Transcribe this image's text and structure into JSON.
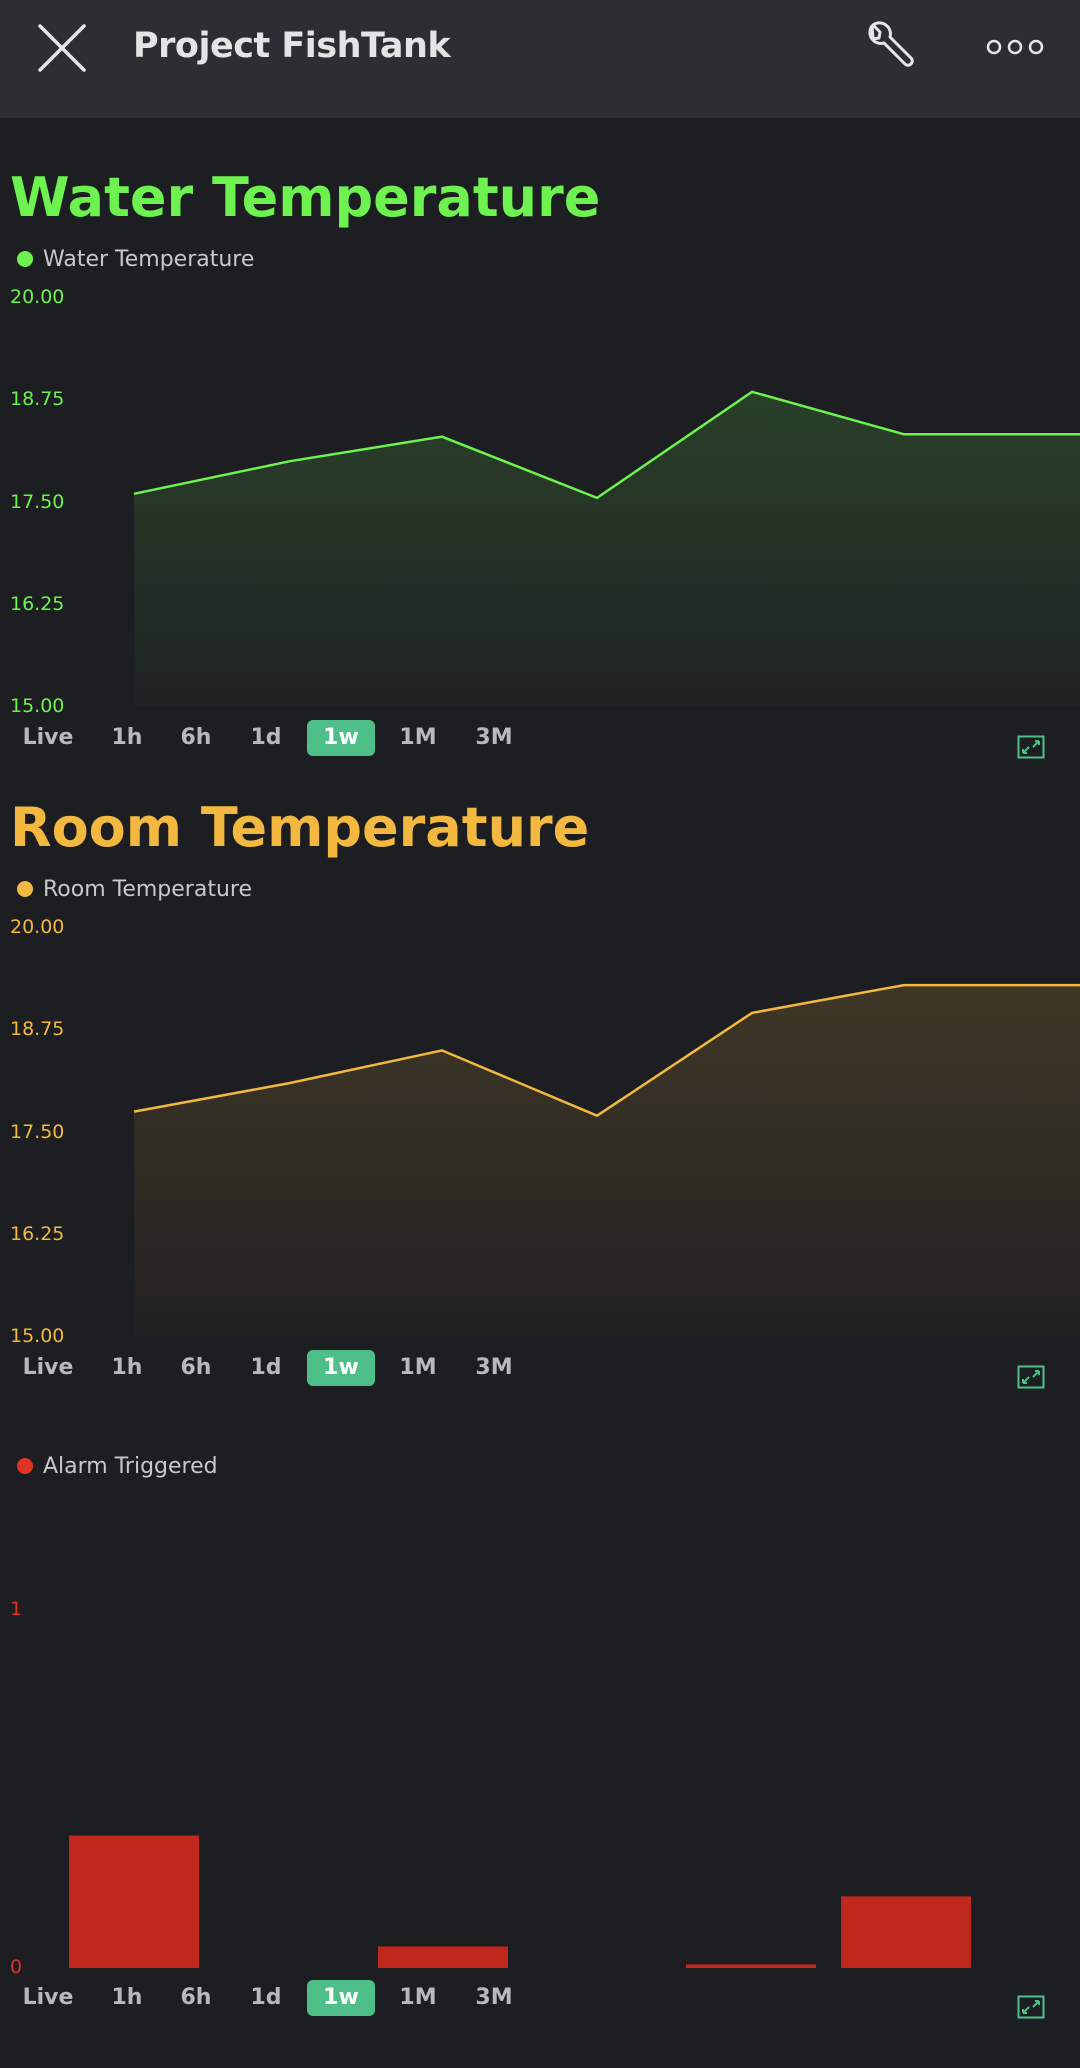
{
  "header": {
    "title": "Project FishTank",
    "icons": {
      "close": "close-icon",
      "settings": "wrench-icon",
      "more": "more-icon"
    }
  },
  "time_ranges": [
    "Live",
    "1h",
    "6h",
    "1d",
    "1w",
    "1M",
    "3M"
  ],
  "active_range": "1w",
  "widgets": {
    "water": {
      "title": "Water Temperature",
      "legend": "Water Temperature",
      "color": "#6ef250",
      "y_ticks": [
        "20.00",
        "18.75",
        "17.50",
        "16.25",
        "15.00"
      ]
    },
    "room": {
      "title": "Room Temperature",
      "legend": "Room Temperature",
      "color": "#f3b83f",
      "y_ticks": [
        "20.00",
        "18.75",
        "17.50",
        "16.25",
        "15.00"
      ]
    },
    "alarm": {
      "legend": "Alarm Triggered",
      "color": "#e03325",
      "y_ticks": [
        "1",
        "0"
      ]
    }
  },
  "chart_data": [
    {
      "type": "area",
      "title": "Water Temperature",
      "ylim": [
        15,
        20
      ],
      "series": [
        {
          "name": "Water Temperature",
          "values": [
            17.6,
            18.0,
            18.3,
            17.55,
            18.85,
            18.33,
            18.33
          ]
        }
      ]
    },
    {
      "type": "area",
      "title": "Room Temperature",
      "ylim": [
        15,
        20
      ],
      "series": [
        {
          "name": "Room Temperature",
          "values": [
            17.75,
            18.1,
            18.5,
            17.7,
            18.96,
            19.3,
            19.3
          ]
        }
      ]
    },
    {
      "type": "bar",
      "ylim": [
        0,
        1
      ],
      "series": [
        {
          "name": "Alarm Triggered",
          "values": [
            0.37,
            0.0,
            0.06,
            0.0,
            0.01,
            0.2
          ]
        }
      ]
    }
  ]
}
